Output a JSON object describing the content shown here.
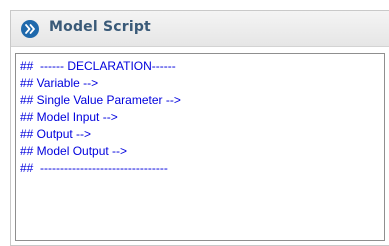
{
  "panel": {
    "title": "Model Script",
    "toggle_icon": "double-chevron-right-icon",
    "accent_color": "#1f69ac",
    "script_text_color": "#0000dd"
  },
  "script": {
    "lines": [
      "##  ------ DECLARATION------",
      "## Variable -->",
      "## Single Value Parameter -->",
      "## Model Input -->",
      "## Output -->",
      "## Model Output -->",
      "##  --------------------------------"
    ]
  }
}
